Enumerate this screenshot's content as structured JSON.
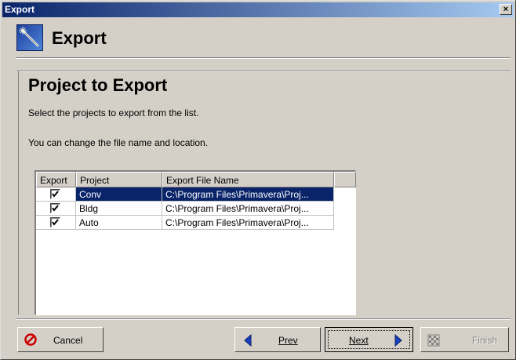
{
  "window": {
    "title": "Export",
    "close_glyph": "×"
  },
  "header": {
    "title": "Export",
    "icon": "wand-icon"
  },
  "page": {
    "title": "Project to Export",
    "instruction1": "Select the projects to export from the list.",
    "instruction2": "You can change the file name and location."
  },
  "table": {
    "columns": [
      "Export",
      "Project",
      "Export File Name",
      ""
    ],
    "rows": [
      {
        "export": "☑",
        "project": "Conv",
        "file": "C:\\Program Files\\Primavera\\Proj...",
        "selected": true
      },
      {
        "export": "☑",
        "project": "Bldg",
        "file": "C:\\Program Files\\Primavera\\Proj...",
        "selected": false
      },
      {
        "export": "☑",
        "project": "Auto",
        "file": "C:\\Program Files\\Primavera\\Proj...",
        "selected": false
      }
    ]
  },
  "buttons": {
    "cancel": "Cancel",
    "prev": "Prev",
    "next": "Next",
    "finish": "Finish"
  },
  "colors": {
    "titlebar": "#0a246a",
    "selection": "#0a246a",
    "cancel_icon": "#cc0000",
    "arrow": "#1c3fbf"
  }
}
